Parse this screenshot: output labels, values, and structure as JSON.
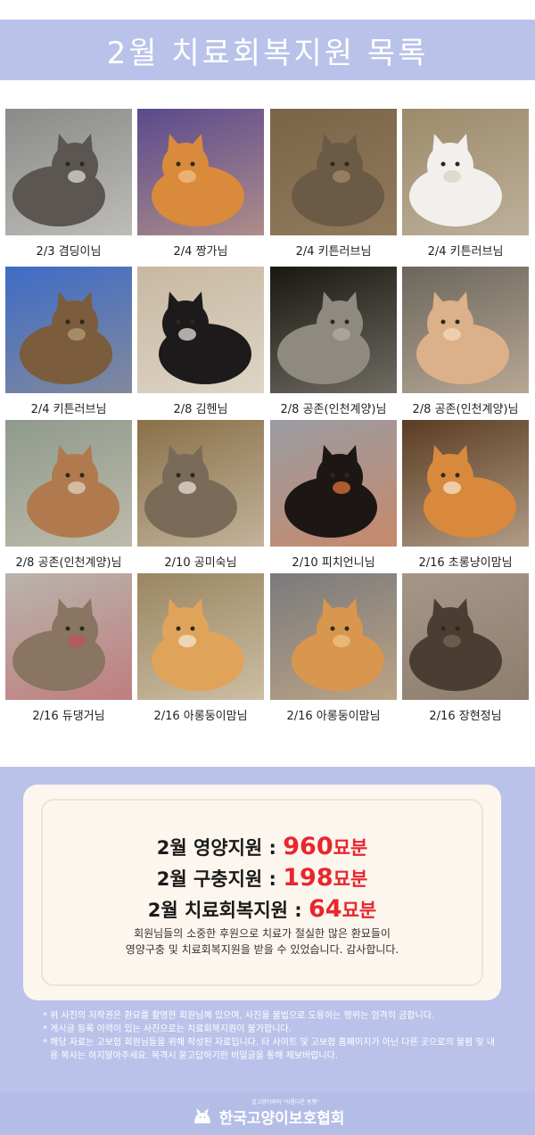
{
  "header": {
    "title": "2월 치료회복지원 목록"
  },
  "cats": [
    {
      "caption": "2/3 겸딩이님",
      "bg": "#8a8a88",
      "cat": "#5b5651",
      "accent": "#e6e4e0"
    },
    {
      "caption": "2/4 짱가님",
      "bg": "#5a4a8c",
      "cat": "#d98a3a",
      "accent": "#f2c28a"
    },
    {
      "caption": "2/4 키튼러브님",
      "bg": "#7a6448",
      "cat": "#6b5a45",
      "accent": "#a58c6c"
    },
    {
      "caption": "2/4 키튼러브님",
      "bg": "#9c8a6a",
      "cat": "#f2f0ec",
      "accent": "#d8cfc2"
    },
    {
      "caption": "2/4 키튼러브님",
      "bg": "#3e6cc6",
      "cat": "#7b5c3c",
      "accent": "#b8a07a"
    },
    {
      "caption": "2/8 김헨님",
      "bg": "#c7b8a0",
      "cat": "#1c1a1a",
      "accent": "#f0ece6"
    },
    {
      "caption": "2/8 공존(인천계양)님",
      "bg": "#1a1712",
      "cat": "#8e8a80",
      "accent": "#b3afa4"
    },
    {
      "caption": "2/8 공존(인천계양)님",
      "bg": "#6b665c",
      "cat": "#dcb088",
      "accent": "#f3dcc0"
    },
    {
      "caption": "2/8 공존(인천계양)님",
      "bg": "#8f9a8c",
      "cat": "#b07a4e",
      "accent": "#e2d6c4"
    },
    {
      "caption": "2/10 공미숙님",
      "bg": "#8a7048",
      "cat": "#7a6a58",
      "accent": "#efe8dc"
    },
    {
      "caption": "2/10 피치언니님",
      "bg": "#9a9ca4",
      "cat": "#1c1614",
      "accent": "#ea7a3a"
    },
    {
      "caption": "2/16 초롱냥이맘님",
      "bg": "#5a3c22",
      "cat": "#d9893c",
      "accent": "#f5e8d6"
    },
    {
      "caption": "2/16  듀댕거님",
      "bg": "#b9b4ac",
      "cat": "#8a7462",
      "accent": "#c5525a"
    },
    {
      "caption": "2/16 아롱둥이맘님",
      "bg": "#9a8662",
      "cat": "#e0a35a",
      "accent": "#f4ead8"
    },
    {
      "caption": "2/16 아롱둥이맘님",
      "bg": "#7a7a7c",
      "cat": "#d8964e",
      "accent": "#efc48c"
    },
    {
      "caption": "2/16 장현정님",
      "bg": "#a69688",
      "cat": "#4a3e32",
      "accent": "#7a6a58"
    }
  ],
  "summary": {
    "nutrition": {
      "label": "2월 영양지원 : ",
      "value": "960",
      "unit": "묘분"
    },
    "deworming": {
      "label": "2월 구충지원 : ",
      "value": "198",
      "unit": "묘분"
    },
    "treatment": {
      "label": "2월 치료회복지원 : ",
      "value": "64",
      "unit": "묘분"
    },
    "thanks_line1": "회원님들의 소중한 후원으로 치료가 절실한 많은 환묘들이",
    "thanks_line2": "영양구충 및 치료회복지원을 받을 수 있었습니다. 감사합니다."
  },
  "notes": [
    "* 위 사진의 저작권은 환묘를 촬영한 회원님께 있으며, 사진을 불법으로 도용하는 행위는 엄격히 금합니다.",
    "* 게시글 등록 이력이 있는 사진으로는 치료회복지원이 불가합니다.",
    "* 해당 자료는 고보협 회원님들을 위해 작성된 자료입니다. 타 사이트 및 고보협 홈페이지가 아닌 다른 곳으로의 불펌 및 내용 복사는 하지말아주세요.  목격시 묻고답하기란 비밀글을 통해 제보바랍니다."
  ],
  "footer": {
    "tagline": "길고양이와의  \"아름다운 동행\"",
    "brand": "한국고양이보호협회"
  }
}
